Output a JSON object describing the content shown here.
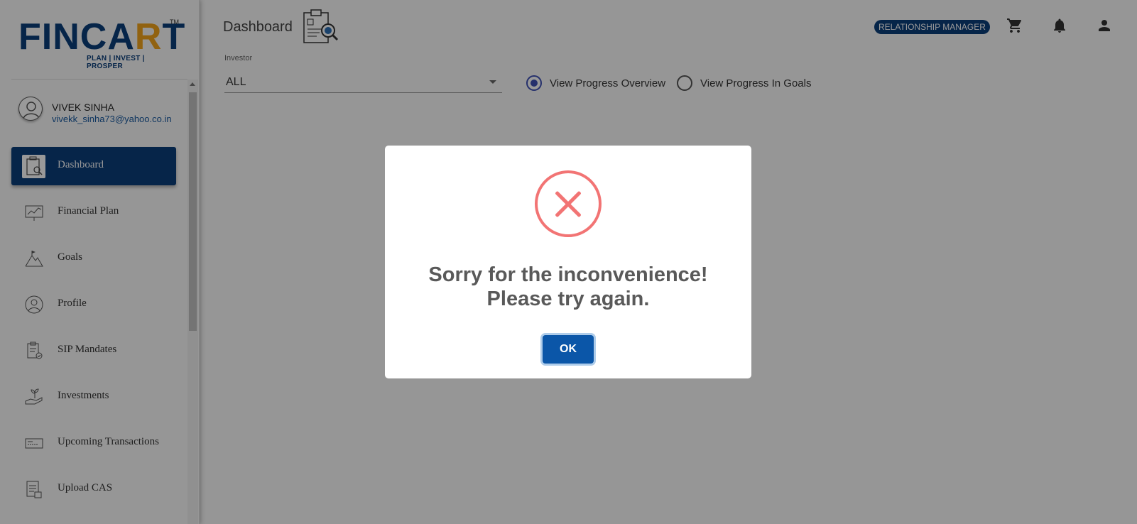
{
  "brand": {
    "logo_text_a": "FINCA",
    "logo_text_b": "R",
    "logo_text_c": "T",
    "tm": "TM",
    "tagline": "PLAN | INVEST | PROSPER"
  },
  "user": {
    "name": "VIVEK SINHA",
    "email": "vivekk_sinha73@yahoo.co.in"
  },
  "sidebar": {
    "items": [
      {
        "label": "Dashboard",
        "active": true
      },
      {
        "label": "Financial Plan"
      },
      {
        "label": "Goals"
      },
      {
        "label": "Profile"
      },
      {
        "label": "SIP Mandates"
      },
      {
        "label": "Investments"
      },
      {
        "label": "Upcoming Transactions"
      },
      {
        "label": "Upload CAS"
      }
    ]
  },
  "header": {
    "title": "Dashboard",
    "role_badge": "RELATIONSHIP MANAGER"
  },
  "filters": {
    "investor_label": "Investor",
    "investor_value": "ALL",
    "radio_overview": "View Progress Overview",
    "radio_goals": "View Progress In Goals",
    "selected": "View Progress Overview"
  },
  "modal": {
    "message": "Sorry for the inconvenience! Please try again.",
    "ok_label": "OK"
  },
  "colors": {
    "brand_blue": "#0b3e7a",
    "brand_orange": "#f2a31b",
    "error_red": "#f27474",
    "button_blue": "#0b56a8"
  }
}
